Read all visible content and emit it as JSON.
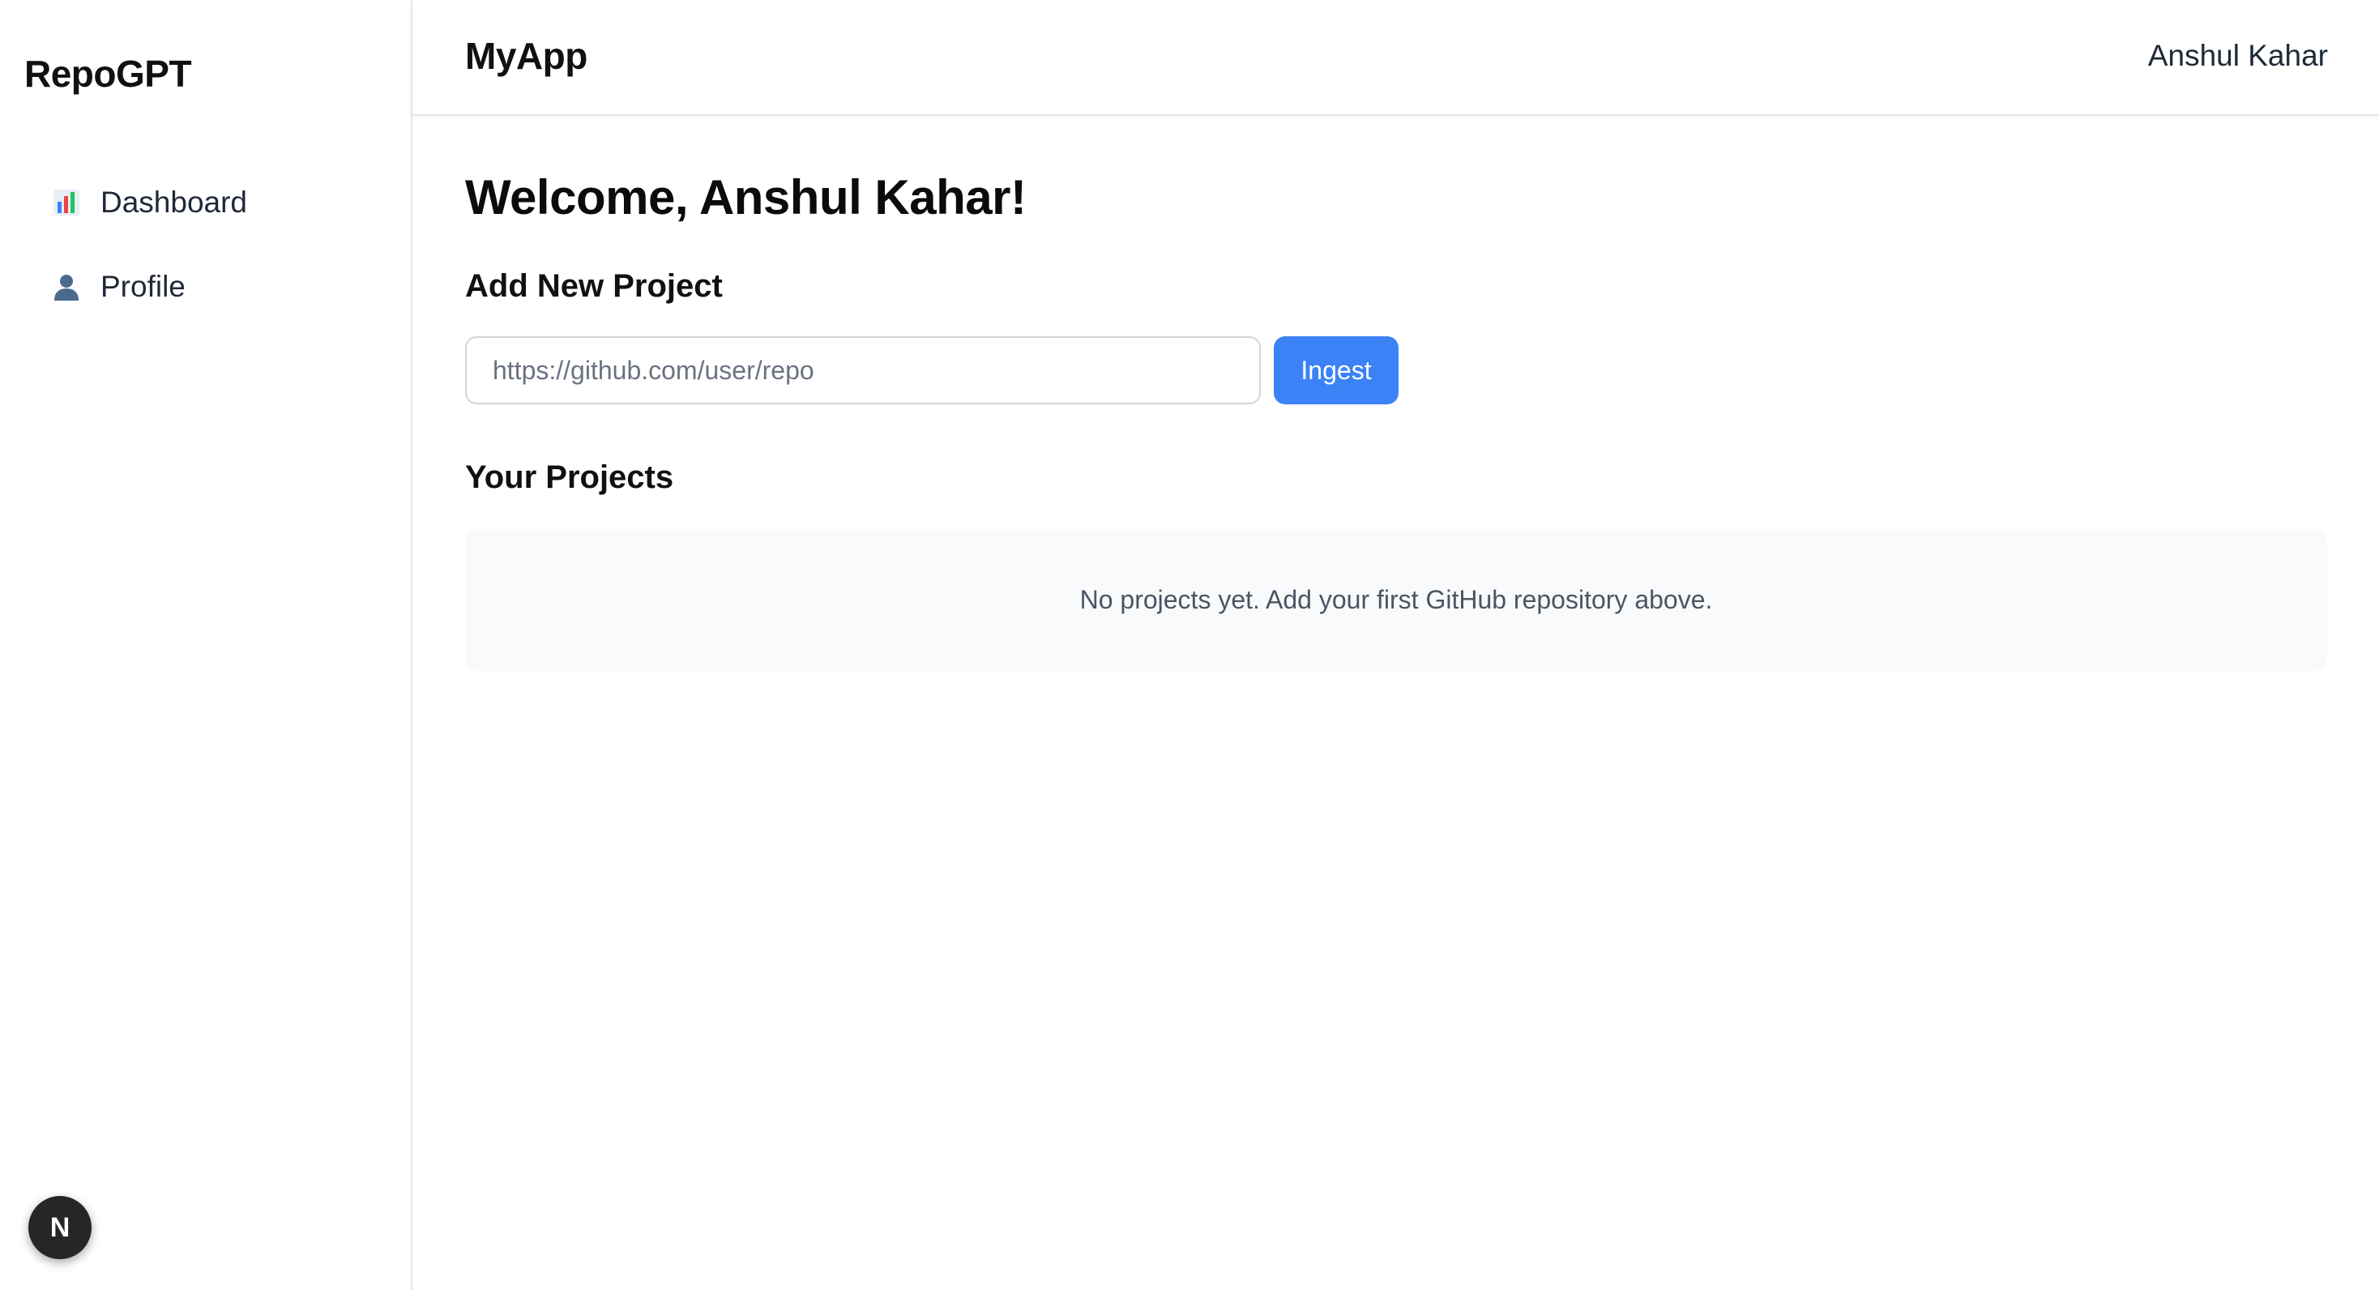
{
  "sidebar": {
    "brand": "RepoGPT",
    "items": [
      {
        "label": "Dashboard",
        "icon": "bar-chart-icon"
      },
      {
        "label": "Profile",
        "icon": "user-icon"
      }
    ],
    "badge_letter": "N"
  },
  "header": {
    "app_title": "MyApp",
    "user_name": "Anshul Kahar"
  },
  "main": {
    "welcome": "Welcome, Anshul Kahar!",
    "add_project_title": "Add New Project",
    "repo_input": {
      "placeholder": "https://github.com/user/repo",
      "value": ""
    },
    "ingest_label": "Ingest",
    "projects_title": "Your Projects",
    "empty_message": "No projects yet. Add your first GitHub repository above."
  },
  "colors": {
    "accent": "#3b82f6",
    "empty_bg": "#f9fafb",
    "border": "#e5e7eb"
  }
}
